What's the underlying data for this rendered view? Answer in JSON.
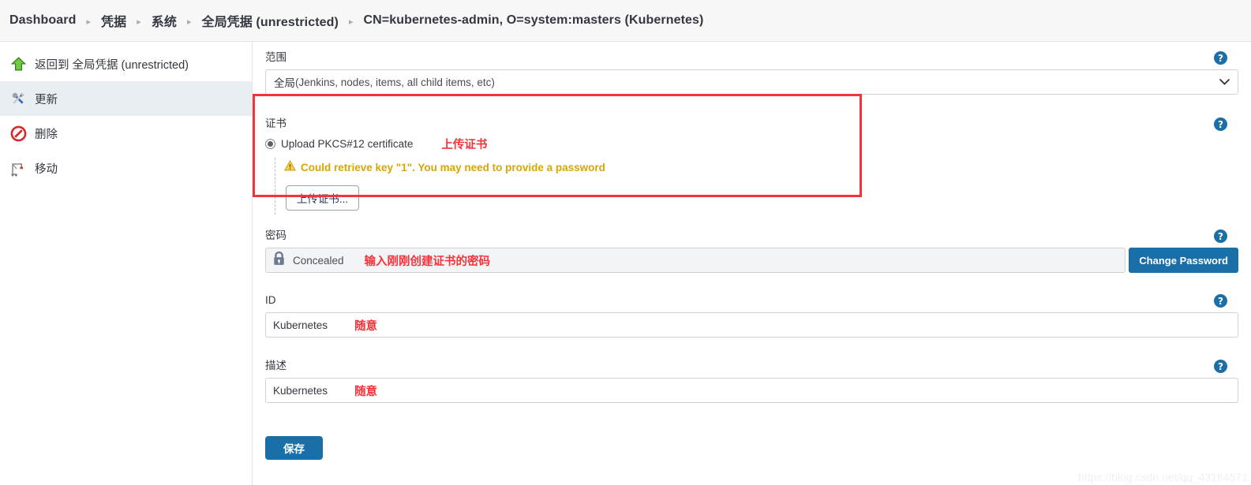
{
  "breadcrumb": {
    "separator": "▸",
    "items": [
      {
        "label": "Dashboard"
      },
      {
        "label": "凭据"
      },
      {
        "label": "系统"
      },
      {
        "label": "全局凭据 (unrestricted)"
      },
      {
        "label": "CN=kubernetes-admin, O=system:masters (Kubernetes)"
      }
    ]
  },
  "sidebar": {
    "items": [
      {
        "label": "返回到 全局凭据 (unrestricted)",
        "icon": "up-arrow-icon",
        "active": false
      },
      {
        "label": "更新",
        "icon": "tools-icon",
        "active": true
      },
      {
        "label": "删除",
        "icon": "no-entry-icon",
        "active": false
      },
      {
        "label": "移动",
        "icon": "crane-move-icon",
        "active": false
      }
    ]
  },
  "form": {
    "scope": {
      "label": "范围",
      "value_bold": "全局",
      "value_rest": " (Jenkins, nodes, items, all child items, etc)",
      "help": "?"
    },
    "certificate": {
      "label": "证书",
      "radio_label": "Upload PKCS#12 certificate",
      "radio_selected": true,
      "annotation": "上传证书",
      "warning": "Could retrieve key \"1\". You may need to provide a password",
      "upload_button": "上传证书...",
      "help": "?"
    },
    "password": {
      "label": "密码",
      "value": "Concealed",
      "annotation": "输入刚刚创建证书的密码",
      "change_button": "Change Password",
      "help": "?"
    },
    "id": {
      "label": "ID",
      "value": "Kubernetes",
      "annotation": "随意",
      "help": "?"
    },
    "description": {
      "label": "描述",
      "value": "Kubernetes",
      "annotation": "随意",
      "help": "?"
    },
    "save_button": "保存"
  },
  "watermark": "https://blog.csdn.net/qq_43164571",
  "colors": {
    "accent_blue": "#1b6fa8",
    "annotation_red": "#f5333b",
    "warning_amber": "#d9a406",
    "sidebar_active": "#e9eef3"
  }
}
